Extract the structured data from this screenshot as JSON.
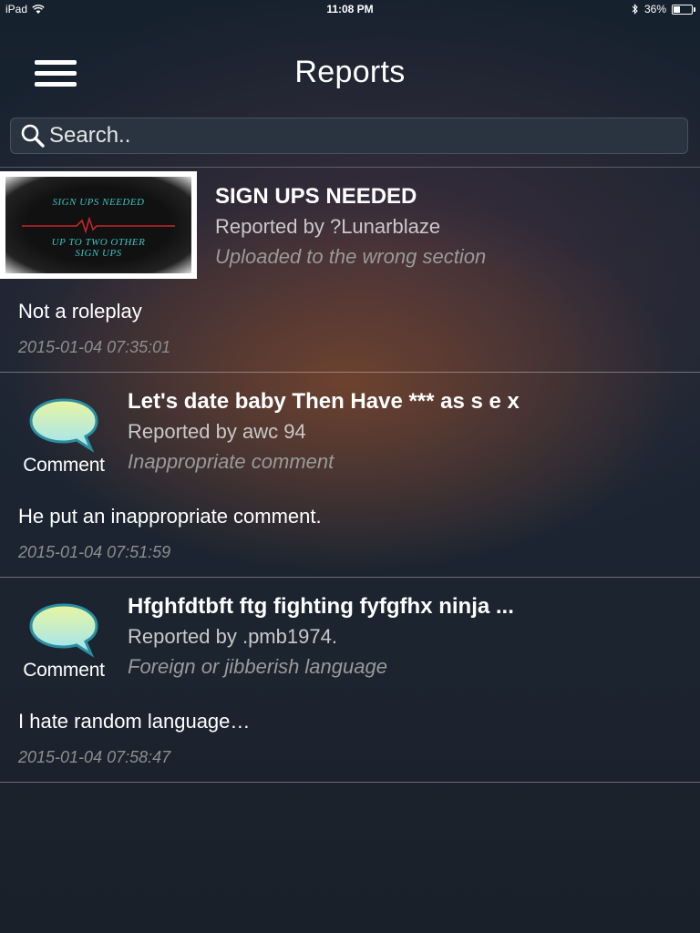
{
  "status": {
    "device": "iPad",
    "time": "11:08 PM",
    "battery": "36%",
    "battery_level": 0.36
  },
  "nav": {
    "title": "Reports"
  },
  "search": {
    "placeholder": "Search.."
  },
  "reports": [
    {
      "type": "image",
      "thumb_lines": [
        "SIGN UPS NEEDED",
        "UP TO TWO OTHER",
        "SIGN UPS"
      ],
      "title": "SIGN UPS NEEDED",
      "reported_by": "Reported by ?Lunarblaze",
      "reason": "Uploaded to the wrong section",
      "description": "Not a roleplay",
      "timestamp": "2015-01-04 07:35:01"
    },
    {
      "type": "comment",
      "icon_label": "Comment",
      "title": "Let's date baby Then Have *** as s e x",
      "reported_by": "Reported by awc 94",
      "reason": "Inappropriate comment",
      "description": "He put an inappropriate comment.",
      "timestamp": "2015-01-04 07:51:59"
    },
    {
      "type": "comment",
      "icon_label": "Comment",
      "title": "Hfghfdtbft ftg fighting fyfgfhx ninja ...",
      "reported_by": "Reported by .pmb1974.",
      "reason": "Foreign or jibberish language",
      "description": "I hate random language…",
      "timestamp": "2015-01-04 07:58:47"
    }
  ],
  "colors": {
    "bubble_fill_top": "#e8f6a0",
    "bubble_fill_bottom": "#9fe3f5",
    "bubble_stroke": "#2a8fa0",
    "thumb_text": "#3fc3bf"
  }
}
